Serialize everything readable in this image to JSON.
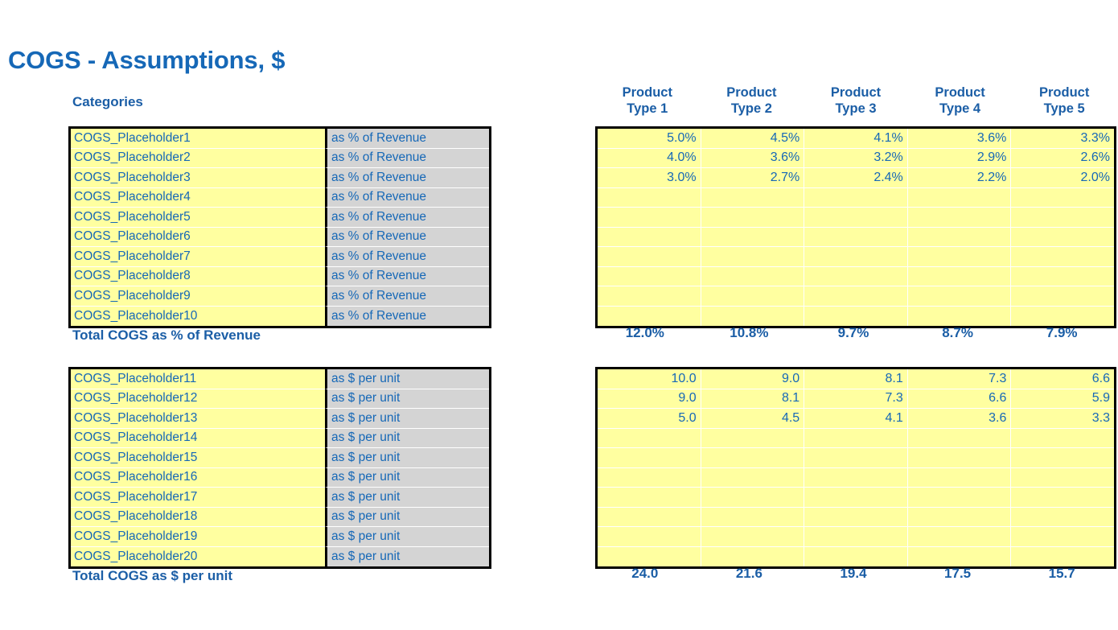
{
  "title": "COGS - Assumptions, $",
  "categories_label": "Categories",
  "column_headers": [
    {
      "line1": "Product",
      "line2": "Type 1"
    },
    {
      "line1": "Product",
      "line2": "Type 2"
    },
    {
      "line1": "Product",
      "line2": "Type 3"
    },
    {
      "line1": "Product",
      "line2": "Type 4"
    },
    {
      "line1": "Product",
      "line2": "Type 5"
    }
  ],
  "colors": {
    "title_blue": "#1668b7",
    "header_blue": "#1b5ea6",
    "cell_yellow": "#ffffa0",
    "cell_gray": "#d4d4d4",
    "border_black": "#000000"
  },
  "section_percent": {
    "unit_label": "as % of Revenue",
    "total_label": "Total COGS as % of Revenue",
    "rows": [
      {
        "name": "COGS_Placeholder1",
        "unit": "as % of Revenue",
        "values": [
          "5.0%",
          "4.5%",
          "4.1%",
          "3.6%",
          "3.3%"
        ]
      },
      {
        "name": "COGS_Placeholder2",
        "unit": "as % of Revenue",
        "values": [
          "4.0%",
          "3.6%",
          "3.2%",
          "2.9%",
          "2.6%"
        ]
      },
      {
        "name": "COGS_Placeholder3",
        "unit": "as % of Revenue",
        "values": [
          "3.0%",
          "2.7%",
          "2.4%",
          "2.2%",
          "2.0%"
        ]
      },
      {
        "name": "COGS_Placeholder4",
        "unit": "as % of Revenue",
        "values": [
          "",
          "",
          "",
          "",
          ""
        ]
      },
      {
        "name": "COGS_Placeholder5",
        "unit": "as % of Revenue",
        "values": [
          "",
          "",
          "",
          "",
          ""
        ]
      },
      {
        "name": "COGS_Placeholder6",
        "unit": "as % of Revenue",
        "values": [
          "",
          "",
          "",
          "",
          ""
        ]
      },
      {
        "name": "COGS_Placeholder7",
        "unit": "as % of Revenue",
        "values": [
          "",
          "",
          "",
          "",
          ""
        ]
      },
      {
        "name": "COGS_Placeholder8",
        "unit": "as % of Revenue",
        "values": [
          "",
          "",
          "",
          "",
          ""
        ]
      },
      {
        "name": "COGS_Placeholder9",
        "unit": "as % of Revenue",
        "values": [
          "",
          "",
          "",
          "",
          ""
        ]
      },
      {
        "name": "COGS_Placeholder10",
        "unit": "as % of Revenue",
        "values": [
          "",
          "",
          "",
          "",
          ""
        ]
      }
    ],
    "totals": [
      "12.0%",
      "10.8%",
      "9.7%",
      "8.7%",
      "7.9%"
    ]
  },
  "section_per_unit": {
    "unit_label": "as $ per unit",
    "total_label": "Total COGS as $ per unit",
    "rows": [
      {
        "name": "COGS_Placeholder11",
        "unit": "as $ per unit",
        "values": [
          "10.0",
          "9.0",
          "8.1",
          "7.3",
          "6.6"
        ]
      },
      {
        "name": "COGS_Placeholder12",
        "unit": "as $ per unit",
        "values": [
          "9.0",
          "8.1",
          "7.3",
          "6.6",
          "5.9"
        ]
      },
      {
        "name": "COGS_Placeholder13",
        "unit": "as $ per unit",
        "values": [
          "5.0",
          "4.5",
          "4.1",
          "3.6",
          "3.3"
        ]
      },
      {
        "name": "COGS_Placeholder14",
        "unit": "as $ per unit",
        "values": [
          "",
          "",
          "",
          "",
          ""
        ]
      },
      {
        "name": "COGS_Placeholder15",
        "unit": "as $ per unit",
        "values": [
          "",
          "",
          "",
          "",
          ""
        ]
      },
      {
        "name": "COGS_Placeholder16",
        "unit": "as $ per unit",
        "values": [
          "",
          "",
          "",
          "",
          ""
        ]
      },
      {
        "name": "COGS_Placeholder17",
        "unit": "as $ per unit",
        "values": [
          "",
          "",
          "",
          "",
          ""
        ]
      },
      {
        "name": "COGS_Placeholder18",
        "unit": "as $ per unit",
        "values": [
          "",
          "",
          "",
          "",
          ""
        ]
      },
      {
        "name": "COGS_Placeholder19",
        "unit": "as $ per unit",
        "values": [
          "",
          "",
          "",
          "",
          ""
        ]
      },
      {
        "name": "COGS_Placeholder20",
        "unit": "as $ per unit",
        "values": [
          "",
          "",
          "",
          "",
          ""
        ]
      }
    ],
    "totals": [
      "24.0",
      "21.6",
      "19.4",
      "17.5",
      "15.7"
    ]
  },
  "chart_data": {
    "type": "table",
    "title": "COGS - Assumptions, $",
    "categories": [
      "Product Type 1",
      "Product Type 2",
      "Product Type 3",
      "Product Type 4",
      "Product Type 5"
    ],
    "tables": [
      {
        "name": "COGS as % of Revenue",
        "row_labels": [
          "COGS_Placeholder1",
          "COGS_Placeholder2",
          "COGS_Placeholder3",
          "COGS_Placeholder4",
          "COGS_Placeholder5",
          "COGS_Placeholder6",
          "COGS_Placeholder7",
          "COGS_Placeholder8",
          "COGS_Placeholder9",
          "COGS_Placeholder10"
        ],
        "series": [
          {
            "name": "COGS_Placeholder1",
            "values": [
              5.0,
              4.5,
              4.1,
              3.6,
              3.3
            ]
          },
          {
            "name": "COGS_Placeholder2",
            "values": [
              4.0,
              3.6,
              3.2,
              2.9,
              2.6
            ]
          },
          {
            "name": "COGS_Placeholder3",
            "values": [
              3.0,
              2.7,
              2.4,
              2.2,
              2.0
            ]
          }
        ],
        "total_label": "Total COGS as % of Revenue",
        "totals": [
          12.0,
          10.8,
          9.7,
          8.7,
          7.9
        ],
        "units": "percent"
      },
      {
        "name": "COGS as $ per unit",
        "row_labels": [
          "COGS_Placeholder11",
          "COGS_Placeholder12",
          "COGS_Placeholder13",
          "COGS_Placeholder14",
          "COGS_Placeholder15",
          "COGS_Placeholder16",
          "COGS_Placeholder17",
          "COGS_Placeholder18",
          "COGS_Placeholder19",
          "COGS_Placeholder20"
        ],
        "series": [
          {
            "name": "COGS_Placeholder11",
            "values": [
              10.0,
              9.0,
              8.1,
              7.3,
              6.6
            ]
          },
          {
            "name": "COGS_Placeholder12",
            "values": [
              9.0,
              8.1,
              7.3,
              6.6,
              5.9
            ]
          },
          {
            "name": "COGS_Placeholder13",
            "values": [
              5.0,
              4.5,
              4.1,
              3.6,
              3.3
            ]
          }
        ],
        "total_label": "Total COGS as $ per unit",
        "totals": [
          24.0,
          21.6,
          19.4,
          17.5,
          15.7
        ],
        "units": "dollars per unit"
      }
    ]
  }
}
